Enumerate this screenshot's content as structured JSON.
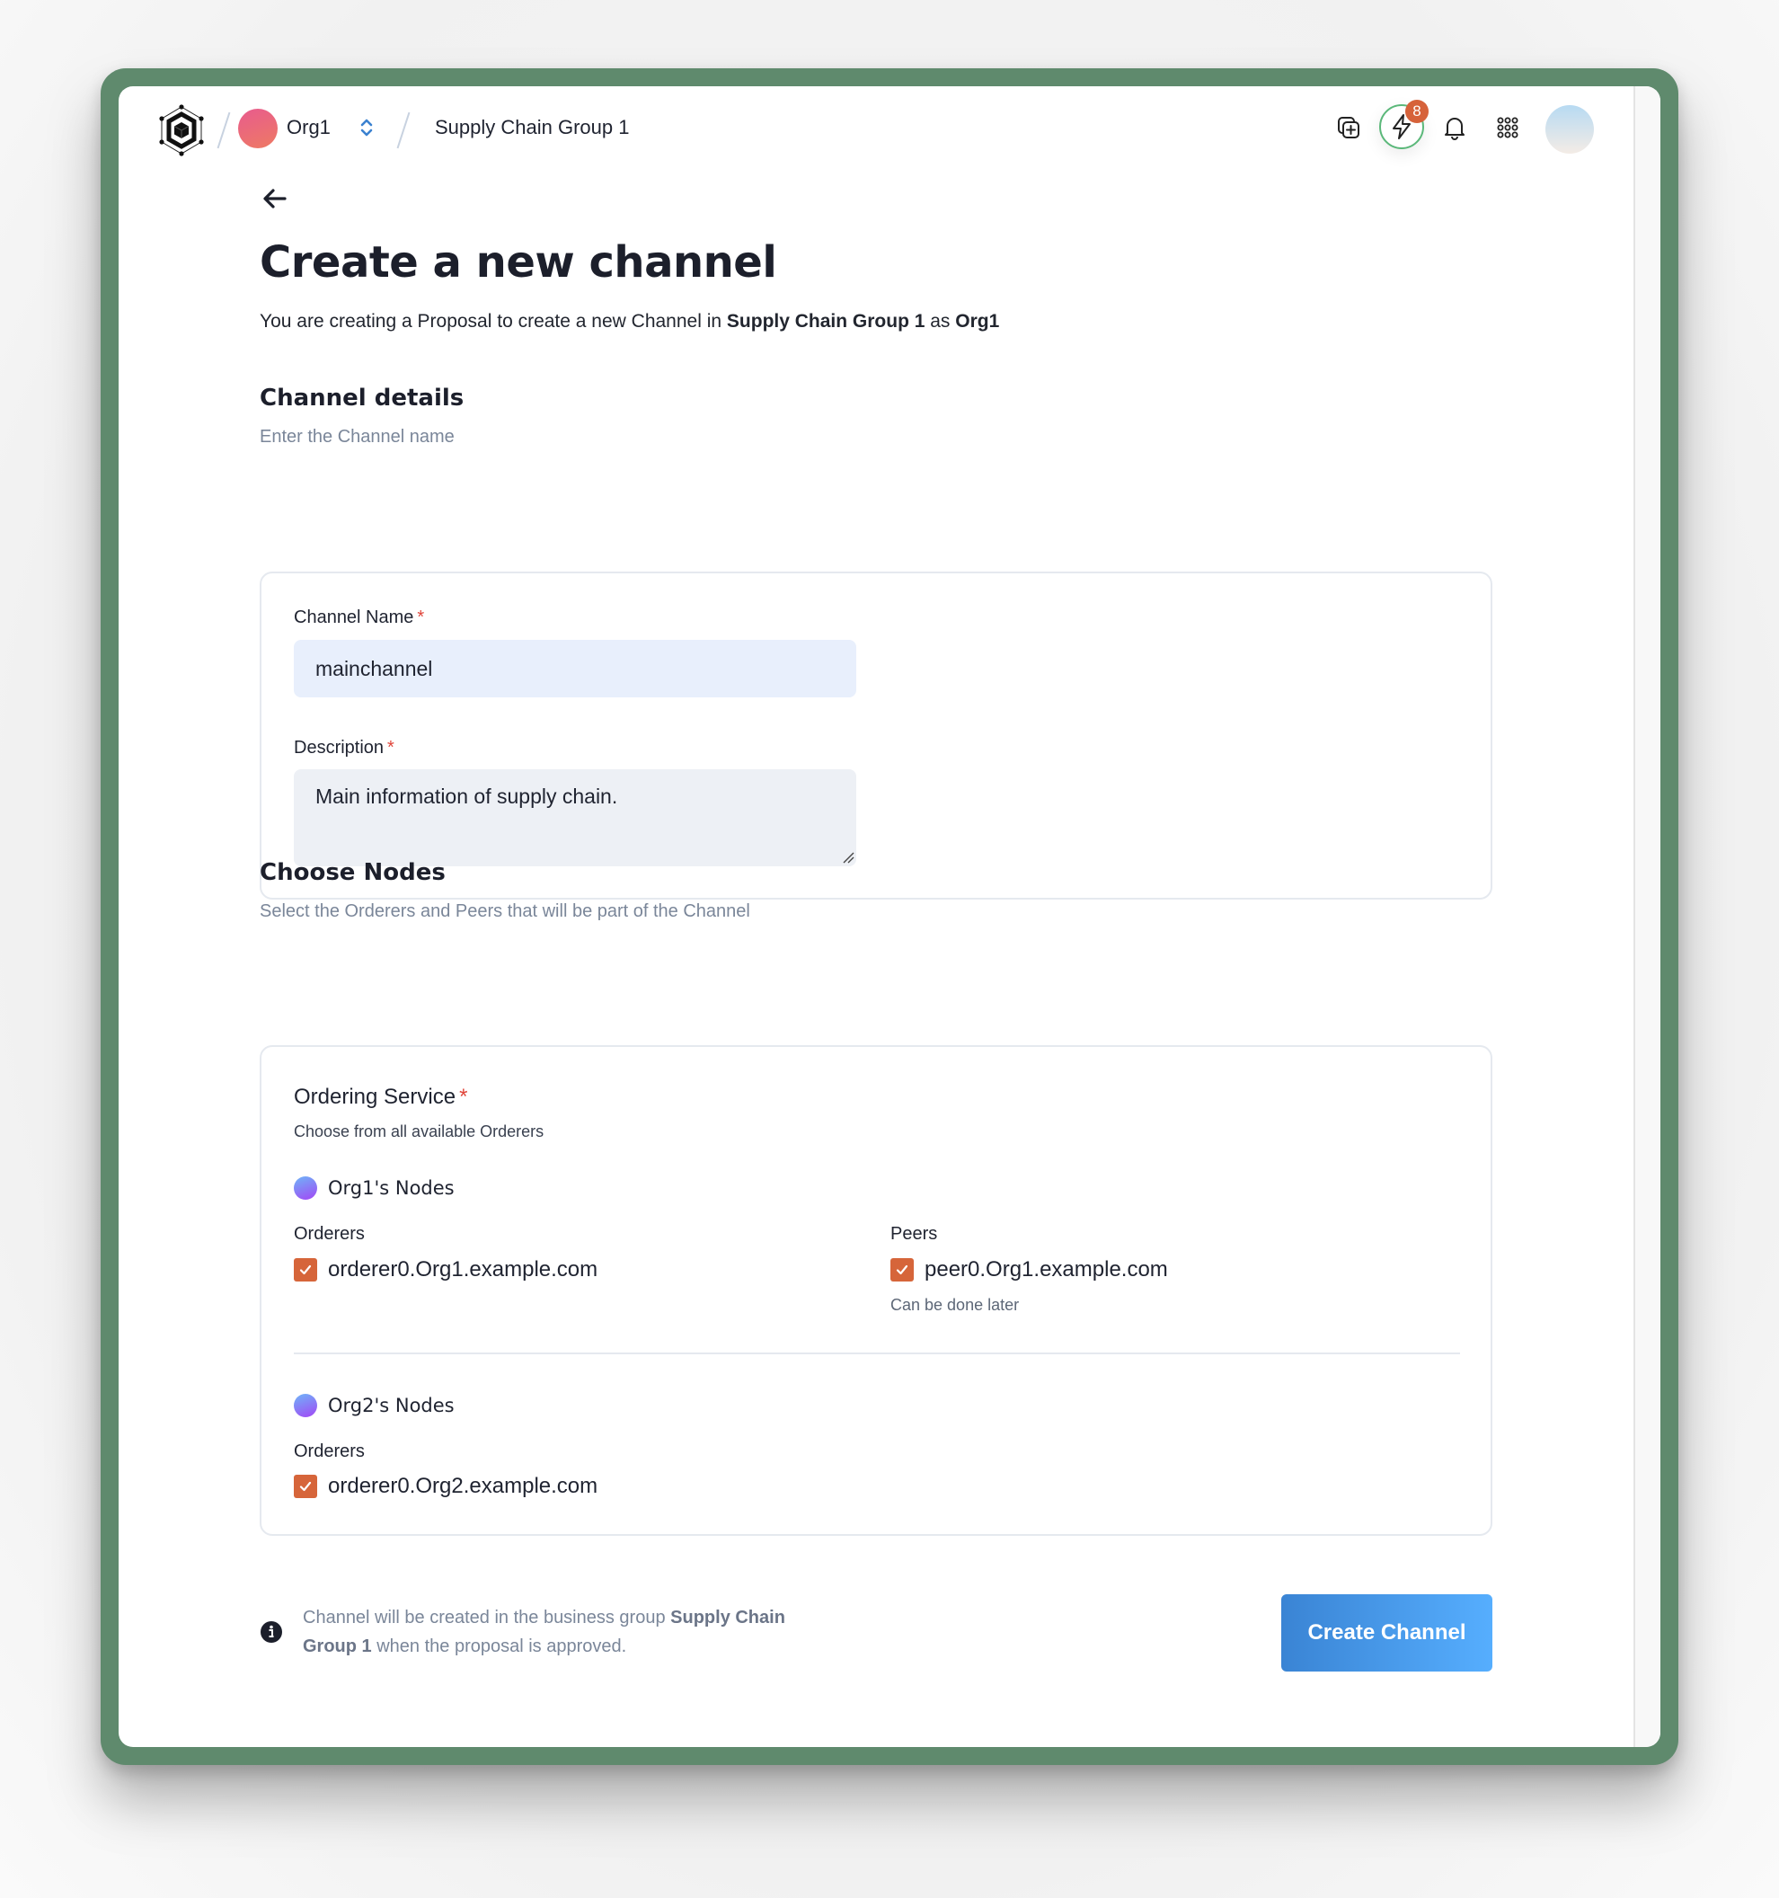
{
  "header": {
    "org_name": "Org1",
    "group_name": "Supply Chain Group 1",
    "notification_count": "8",
    "icons": [
      "logo-icon",
      "org-switch-icon",
      "add-copy-icon",
      "bolt-icon",
      "bell-icon",
      "apps-grid-icon",
      "user-avatar"
    ]
  },
  "page": {
    "title": "Create a new channel",
    "subtitle_pre": "You are creating a Proposal to create a new Channel in ",
    "subtitle_group": "Supply Chain Group 1",
    "subtitle_mid": " as ",
    "subtitle_org": "Org1"
  },
  "channel_details": {
    "title": "Channel details",
    "subtitle": "Enter the Channel name",
    "name_label": "Channel Name",
    "name_value": "mainchannel",
    "description_label": "Description",
    "description_value": "Main information of supply chain.",
    "required_mark": "*"
  },
  "choose_nodes": {
    "title": "Choose Nodes",
    "subtitle": "Select the Orderers and Peers that will be part of the Channel",
    "ordering_service_label": "Ordering Service",
    "ordering_service_hint": "Choose from all available Orderers",
    "required_mark": "*",
    "groups": [
      {
        "name": "Org1's Nodes",
        "orderers_label": "Orderers",
        "orderers": [
          {
            "label": "orderer0.Org1.example.com",
            "checked": true
          }
        ],
        "peers_label": "Peers",
        "peers": [
          {
            "label": "peer0.Org1.example.com",
            "checked": true
          }
        ],
        "peers_hint": "Can be done later"
      },
      {
        "name": "Org2's Nodes",
        "orderers_label": "Orderers",
        "orderers": [
          {
            "label": "orderer0.Org2.example.com",
            "checked": true
          }
        ]
      }
    ]
  },
  "footer": {
    "note_pre": "Channel will be created in the business group ",
    "note_group": "Supply Chain Group 1",
    "note_post": " when the proposal is approved.",
    "create_button": "Create Channel"
  },
  "colors": {
    "frame": "#5f8a6d",
    "accent_checkbox": "#d6653a",
    "badge": "#d6623a",
    "button_start": "#3a84d4",
    "button_end": "#56aefe",
    "required": "#e0453a"
  }
}
